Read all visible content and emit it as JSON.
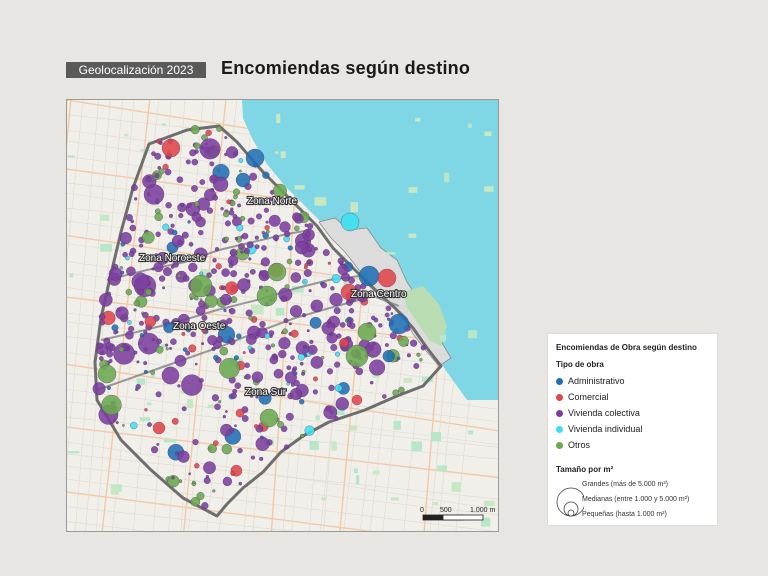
{
  "header": {
    "tag": "Geolocalización 2023",
    "title": "Encomiendas según destino"
  },
  "map": {
    "zones": [
      {
        "name": "Zona Norte"
      },
      {
        "name": "Zona Noroeste"
      },
      {
        "name": "Zona Centro"
      },
      {
        "name": "Zona Oeste"
      },
      {
        "name": "Zona Sur"
      }
    ],
    "scale": {
      "ticks": [
        "0",
        "500",
        "1.000 m"
      ]
    },
    "colors": {
      "water": "#7fd6e4",
      "land": "#f1efe9",
      "green": "#c8e8c4",
      "boundary": "#6e6e6e"
    }
  },
  "legend": {
    "title": "Encomiendas de Obra según destino",
    "type_heading": "Tipo de obra",
    "types": [
      {
        "label": "Administrativo",
        "color": "#1f6fb4"
      },
      {
        "label": "Comercial",
        "color": "#e0454a"
      },
      {
        "label": "Vivienda colectiva",
        "color": "#7b3f9e"
      },
      {
        "label": "Vivienda individual",
        "color": "#3ee0f0"
      },
      {
        "label": "Otros",
        "color": "#6aa84f"
      }
    ],
    "size_heading": "Tamaño por m²",
    "sizes": [
      {
        "label": "Grandes (más de 5.000 m²)"
      },
      {
        "label": "Medianas (entre 1.000 y 5.000 m²)"
      },
      {
        "label": "Pequeñas (hasta 1.000 m²)"
      }
    ]
  }
}
